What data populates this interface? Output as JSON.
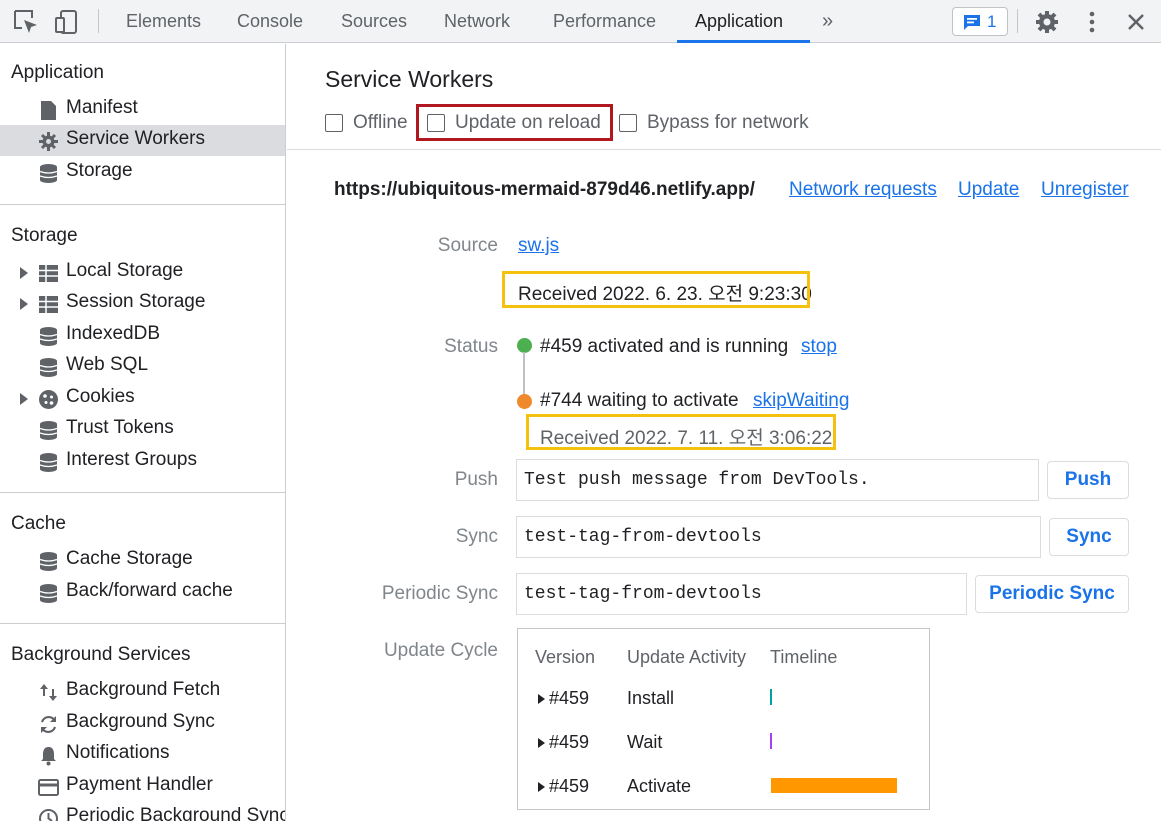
{
  "toolbar": {
    "tabs": [
      "Elements",
      "Console",
      "Sources",
      "Network",
      "Performance",
      "Application"
    ],
    "more": "»",
    "issues_count": "1"
  },
  "sidebar": {
    "sections": {
      "application": "Application",
      "storage": "Storage",
      "cache": "Cache",
      "background_services": "Background Services"
    },
    "application_items": [
      "Manifest",
      "Service Workers",
      "Storage"
    ],
    "storage_items": [
      "Local Storage",
      "Session Storage",
      "IndexedDB",
      "Web SQL",
      "Cookies",
      "Trust Tokens",
      "Interest Groups"
    ],
    "cache_items": [
      "Cache Storage",
      "Back/forward cache"
    ],
    "background_items": [
      "Background Fetch",
      "Background Sync",
      "Notifications",
      "Payment Handler",
      "Periodic Background Sync"
    ]
  },
  "main": {
    "title": "Service Workers",
    "checkboxes": {
      "offline": "Offline",
      "update_on_reload": "Update on reload",
      "bypass": "Bypass for network"
    },
    "scope_url": "https://ubiquitous-mermaid-879d46.netlify.app/",
    "links": {
      "network_requests": "Network requests",
      "update": "Update",
      "unregister": "Unregister"
    },
    "labels": {
      "source": "Source",
      "status": "Status",
      "push": "Push",
      "sync": "Sync",
      "periodic_sync": "Periodic Sync",
      "update_cycle": "Update Cycle"
    },
    "source_link": "sw.js",
    "source_received": "Received 2022. 6. 23. 오전 9:23:30",
    "status": {
      "active": "#459 activated and is running",
      "active_action": "stop",
      "active_color": "#4caf50",
      "waiting": "#744 waiting to activate",
      "waiting_action": "skipWaiting",
      "waiting_color": "#f0892b",
      "waiting_received": "Received 2022. 7. 11. 오전 3:06:22"
    },
    "push_value": "Test push message from DevTools.",
    "push_button": "Push",
    "sync_value": "test-tag-from-devtools",
    "sync_button": "Sync",
    "periodic_sync_value": "test-tag-from-devtools",
    "periodic_sync_button": "Periodic Sync",
    "update_cycle": {
      "headers": [
        "Version",
        "Update Activity",
        "Timeline"
      ],
      "rows": [
        {
          "version": "#459",
          "activity": "Install",
          "color": "#00a1a1"
        },
        {
          "version": "#459",
          "activity": "Wait",
          "color": "#a142f4"
        },
        {
          "version": "#459",
          "activity": "Activate",
          "color": "#ff9800"
        }
      ]
    }
  }
}
